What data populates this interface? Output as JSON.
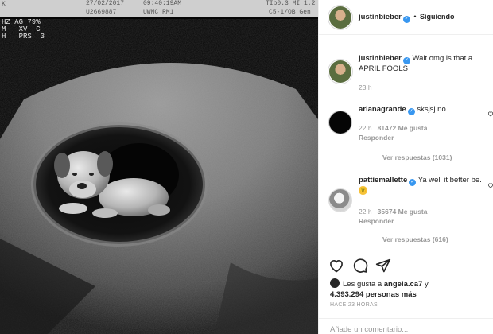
{
  "ultrasound": {
    "header": {
      "top_left": "K",
      "date": "27/02/2017",
      "patient_id": "U2669887",
      "time": "09:40:19AM",
      "clinic": "UWMC RM1",
      "index": "TIb0.3 MI 1.2",
      "probe": "C5-1/OB Gen"
    },
    "side_lines": [
      "HZ AG 79%",
      "M   XV  C",
      "H   PRS  3"
    ]
  },
  "post": {
    "header": {
      "username": "justinbieber",
      "separator": "•",
      "follow_status": "Siguiendo"
    },
    "caption": {
      "username": "justinbieber",
      "text": "Wait omg is that a... APRIL FOOLS",
      "time": "23 h"
    },
    "comments": [
      {
        "username": "arianagrande",
        "text": "sksjsj no",
        "time": "22 h",
        "likes": "81472 Me gusta",
        "reply_label": "Responder",
        "view_replies": "Ver respuestas (1031)"
      },
      {
        "username": "pattiemallette",
        "text": "Ya well it better be.",
        "emoji": "😉",
        "time": "22 h",
        "likes": "35674 Me gusta",
        "reply_label": "Responder",
        "view_replies": "Ver respuestas (616)"
      }
    ],
    "likes_line": {
      "prefix": "Les gusta a",
      "user": "angela.ca7",
      "conj": "y",
      "count": "4.393.294 personas más"
    },
    "posted_ago": "HACE 23 HORAS",
    "add_comment_placeholder": "Añade un comentario..."
  },
  "colors": {
    "verified": "#3897f0",
    "muted": "#999999",
    "text": "#262626"
  }
}
